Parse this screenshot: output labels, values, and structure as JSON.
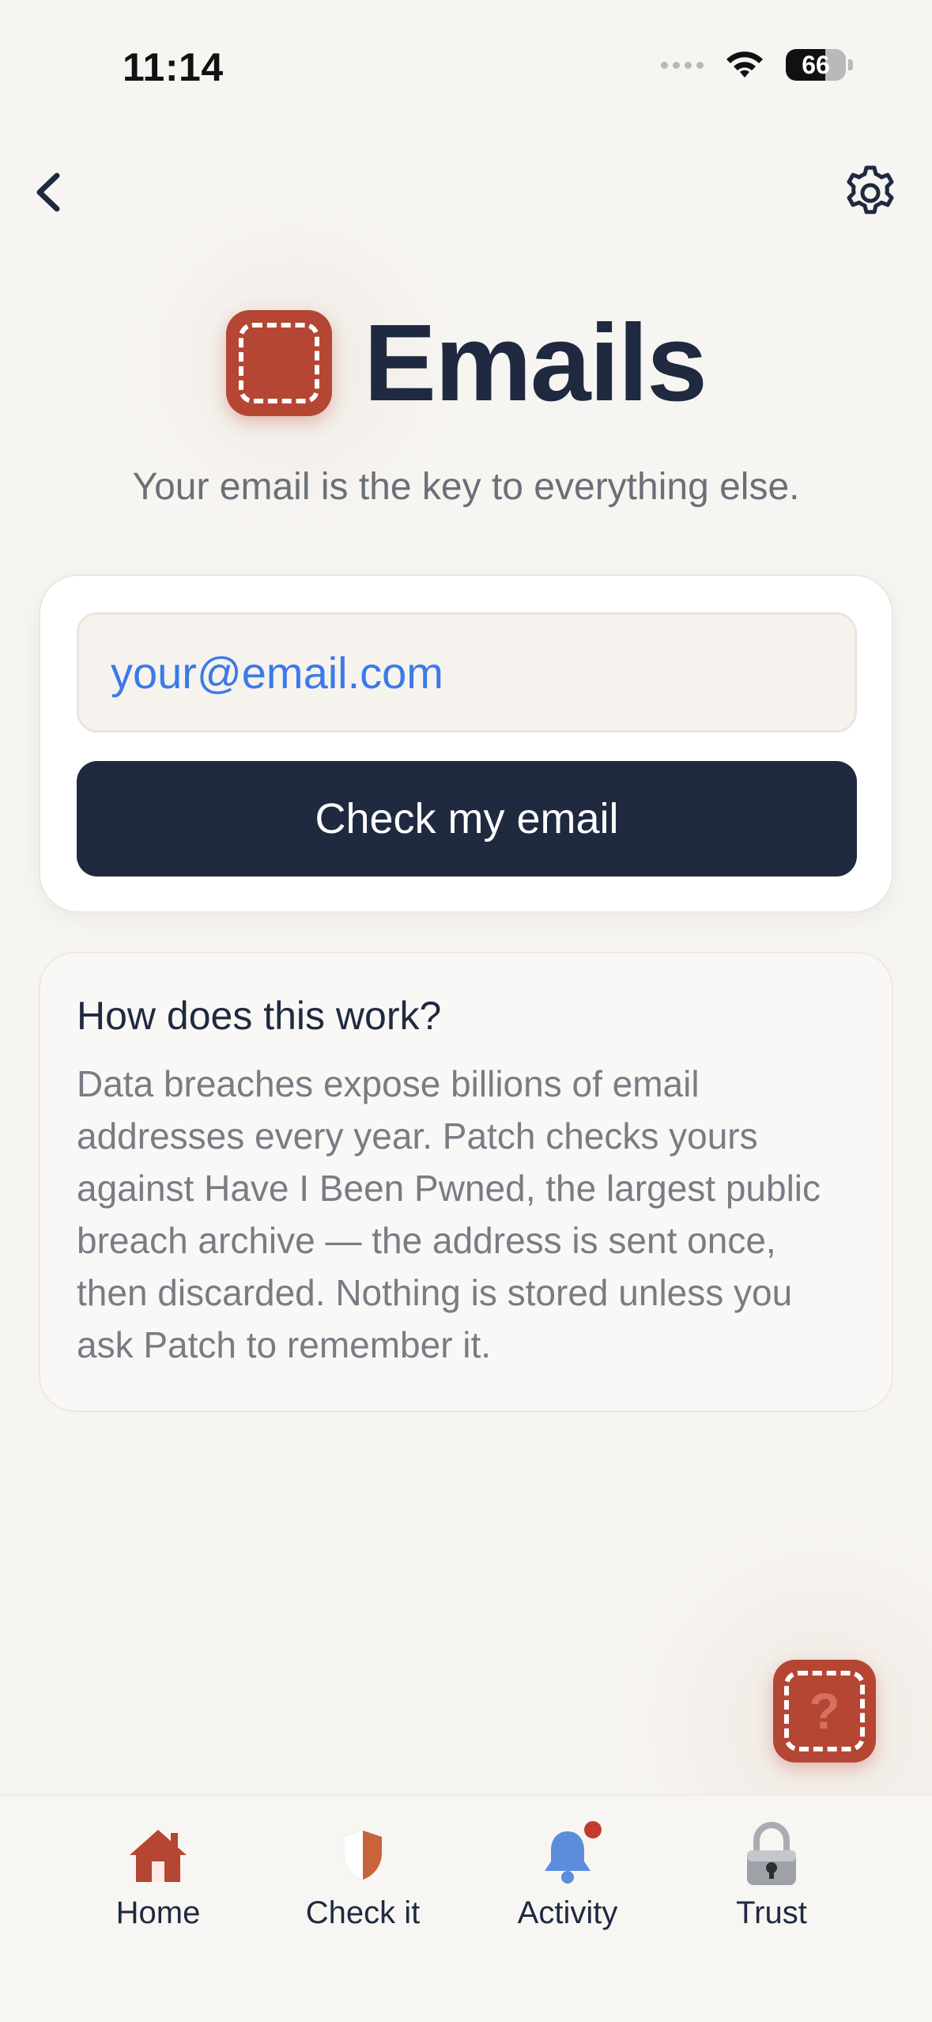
{
  "status_bar": {
    "time": "11:14",
    "battery_percent": "66",
    "battery_level": 0.66
  },
  "nav": {
    "back_icon": "chevron-left-icon",
    "settings_icon": "gear-icon"
  },
  "hero": {
    "title": "Emails",
    "subtitle": "Your email is the key to everything else."
  },
  "check_form": {
    "email_placeholder": "your@email.com",
    "email_value": "",
    "submit_label": "Check my email"
  },
  "info": {
    "title": "How does this work?",
    "body": "Data breaches expose billions of email addresses every year. Patch checks yours against Have I Been Pwned, the largest public breach archive — the address is sent once, then discarded. Nothing is stored unless you ask Patch to remember it."
  },
  "help": {
    "mark": "?"
  },
  "tabbar": {
    "tabs": [
      {
        "label": "Home",
        "icon": "house-icon"
      },
      {
        "label": "Check it",
        "icon": "shield-icon"
      },
      {
        "label": "Activity",
        "icon": "bell-icon"
      },
      {
        "label": "Trust",
        "icon": "padlock-icon"
      }
    ]
  },
  "colors": {
    "background": "#f7f5f2",
    "brand_red": "#b54634",
    "navy": "#1f2a40",
    "link_blue": "#3b7ae8",
    "muted_text": "#787c84",
    "notification_red": "#c43a2e",
    "bell_blue": "#5b8ddb"
  }
}
